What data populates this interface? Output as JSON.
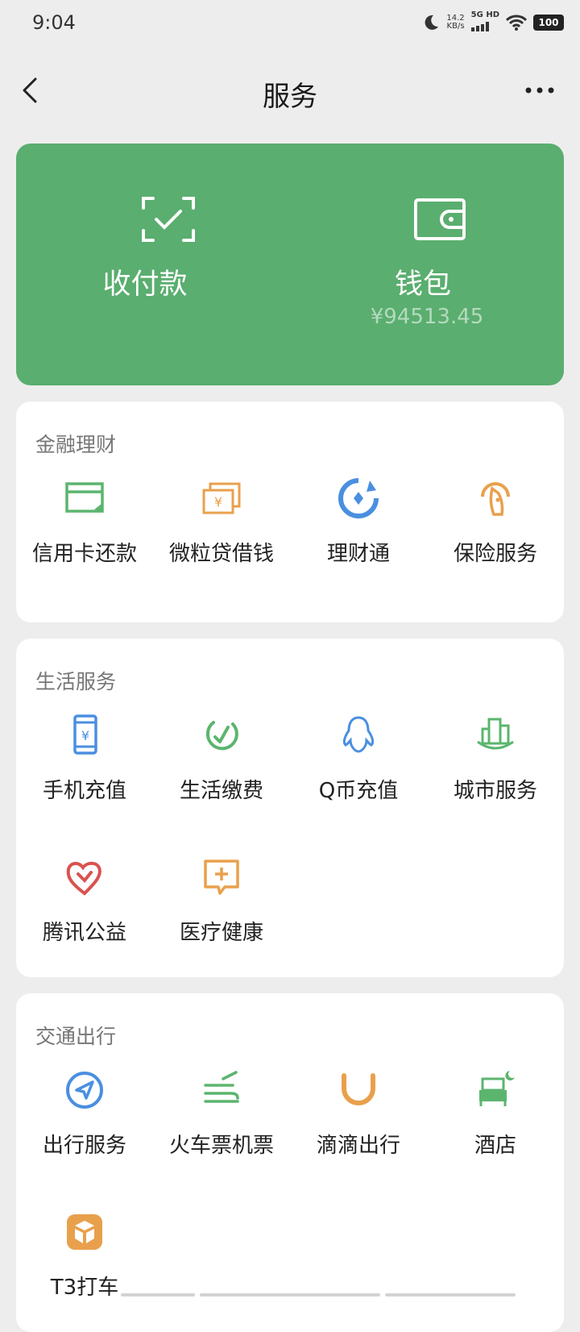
{
  "status": {
    "time": "9:04",
    "net_speed": "14.2",
    "net_unit": "KB/s",
    "net_type": "5G HD",
    "battery": "100"
  },
  "nav": {
    "title": "服务"
  },
  "wallet_card": {
    "pay_label": "收付款",
    "wallet_label": "钱包",
    "balance": "¥94513.45",
    "bg_color": "#5aae6f"
  },
  "sections": [
    {
      "title": "金融理财",
      "items": [
        {
          "label": "信用卡还款",
          "icon": "credit-card-icon"
        },
        {
          "label": "微粒贷借钱",
          "icon": "loan-icon"
        },
        {
          "label": "理财通",
          "icon": "wealth-icon"
        },
        {
          "label": "保险服务",
          "icon": "insurance-icon"
        }
      ]
    },
    {
      "title": "生活服务",
      "items": [
        {
          "label": "手机充值",
          "icon": "phone-recharge-icon"
        },
        {
          "label": "生活缴费",
          "icon": "utility-payment-icon"
        },
        {
          "label": "Q币充值",
          "icon": "qq-coin-icon"
        },
        {
          "label": "城市服务",
          "icon": "city-service-icon"
        },
        {
          "label": "腾讯公益",
          "icon": "charity-icon"
        },
        {
          "label": "医疗健康",
          "icon": "medical-icon"
        }
      ]
    },
    {
      "title": "交通出行",
      "items": [
        {
          "label": "出行服务",
          "icon": "travel-icon"
        },
        {
          "label": "火车票机票",
          "icon": "train-flight-icon"
        },
        {
          "label": "滴滴出行",
          "icon": "didi-icon"
        },
        {
          "label": "酒店",
          "icon": "hotel-icon"
        },
        {
          "label": "T3打车",
          "icon": "t3-taxi-icon"
        }
      ]
    }
  ],
  "colors": {
    "green": "#5bb56e",
    "orange": "#e9a04c",
    "blue": "#4a8fe0",
    "red": "#d9534f"
  }
}
